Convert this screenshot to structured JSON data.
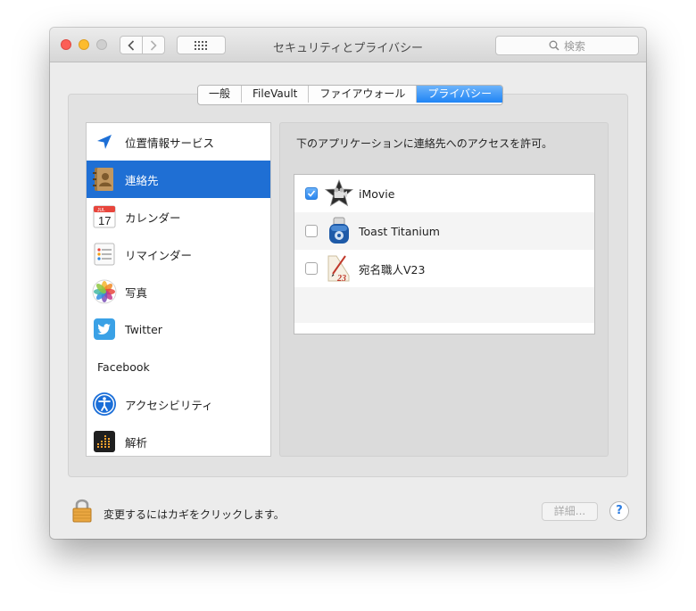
{
  "window": {
    "title": "セキュリティとプライバシー"
  },
  "search": {
    "placeholder": "検索"
  },
  "tabs": [
    {
      "label": "一般"
    },
    {
      "label": "FileVault"
    },
    {
      "label": "ファイアウォール"
    },
    {
      "label": "プライバシー",
      "active": true
    }
  ],
  "sidebar": {
    "items": [
      {
        "label": "位置情報サービス",
        "icon": "location-arrow-icon"
      },
      {
        "label": "連絡先",
        "icon": "contacts-book-icon",
        "selected": true
      },
      {
        "label": "カレンダー",
        "icon": "calendar-icon",
        "icon_month": "JUL",
        "icon_day": "17"
      },
      {
        "label": "リマインダー",
        "icon": "reminders-icon"
      },
      {
        "label": "写真",
        "icon": "photos-icon"
      },
      {
        "label": "Twitter",
        "icon": "twitter-icon"
      },
      {
        "label": "Facebook"
      },
      {
        "label": "アクセシビリティ",
        "icon": "accessibility-icon"
      },
      {
        "label": "解析",
        "icon": "analytics-icon"
      }
    ]
  },
  "main": {
    "description": "下のアプリケーションに連絡先へのアクセスを許可。",
    "apps": [
      {
        "name": "iMovie",
        "checked": true,
        "icon": "imovie-star-icon"
      },
      {
        "name": "Toast Titanium",
        "checked": false,
        "icon": "toast-titanium-icon"
      },
      {
        "name": "宛名職人V23",
        "checked": false,
        "icon": "atena-pen-icon",
        "icon_text": "23"
      }
    ]
  },
  "footer": {
    "lock_text": "変更するにはカギをクリックします。",
    "details_label": "詳細...",
    "help_label": "?"
  },
  "colors": {
    "selection_blue": "#1f6fd4",
    "tab_active": "#1f84f5",
    "close": "#fc5f57",
    "minimize": "#fdbc2e"
  }
}
